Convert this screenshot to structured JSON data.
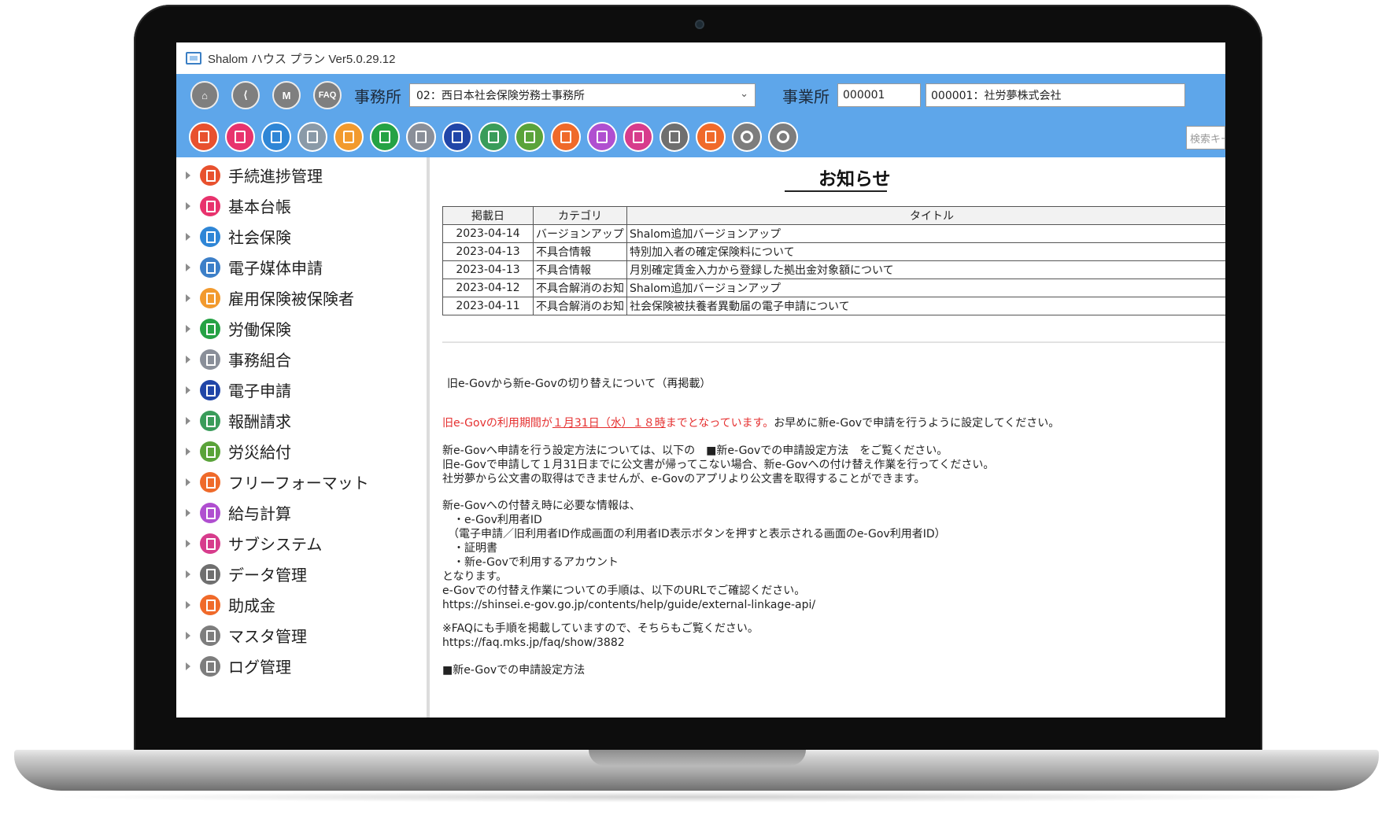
{
  "app": {
    "title": "Shalom ハウス プラン Ver5.0.29.12"
  },
  "toolbar": {
    "top_icons": [
      {
        "name": "home-icon",
        "glyph": "⌂"
      },
      {
        "name": "back-icon",
        "glyph": "⟨"
      },
      {
        "name": "manual-icon",
        "glyph": "M"
      },
      {
        "name": "faq-icon",
        "glyph": "FAQ"
      }
    ],
    "jimusho_label": "事務所",
    "jimusho_value": "02：西日本社会保険労務士事務所",
    "jigyosho_label": "事業所",
    "jigyosho_code": "000001",
    "jigyosho_name": "000001：社労夢株式会社",
    "search_placeholder": "検索キーワード",
    "function_icons": [
      {
        "name": "progress-icon",
        "color": "#e8512e"
      },
      {
        "name": "ledger-icon",
        "color": "#e8336d"
      },
      {
        "name": "social-insurance-icon",
        "color": "#2f86d6"
      },
      {
        "name": "media-icon",
        "color": "#8a9aa8"
      },
      {
        "name": "employment-insurance-icon",
        "color": "#f29a2e"
      },
      {
        "name": "labor-insurance-icon",
        "color": "#25a244"
      },
      {
        "name": "association-icon",
        "color": "#8a8f99"
      },
      {
        "name": "e-application-icon",
        "color": "#2146a8"
      },
      {
        "name": "fee-icon",
        "color": "#3a9c5a"
      },
      {
        "name": "accident-icon",
        "color": "#5aa33a"
      },
      {
        "name": "free-format-icon",
        "color": "#ef6a2a"
      },
      {
        "name": "payroll-icon",
        "color": "#b04fd0"
      },
      {
        "name": "subsystem-icon",
        "color": "#d73c8c"
      },
      {
        "name": "data-icon",
        "color": "#6f6f6f"
      },
      {
        "name": "subsidy-icon",
        "color": "#f06a2a"
      },
      {
        "name": "master-gear-icon",
        "color": "#7d7d7d"
      },
      {
        "name": "log-gear-icon",
        "color": "#7d7d7d"
      }
    ]
  },
  "sidebar": {
    "items": [
      {
        "label": "手続進捗管理",
        "color": "#e8512e",
        "icon": "progress-icon"
      },
      {
        "label": "基本台帳",
        "color": "#e8336d",
        "icon": "ledger-icon"
      },
      {
        "label": "社会保険",
        "color": "#2f86d6",
        "icon": "social-insurance-icon"
      },
      {
        "label": "電子媒体申請",
        "color": "#3c7fc8",
        "icon": "media-icon"
      },
      {
        "label": "雇用保険被保険者",
        "color": "#f29a2e",
        "icon": "employment-insurance-icon"
      },
      {
        "label": "労働保険",
        "color": "#25a244",
        "icon": "labor-insurance-icon"
      },
      {
        "label": "事務組合",
        "color": "#8a8f99",
        "icon": "association-icon"
      },
      {
        "label": "電子申請",
        "color": "#2146a8",
        "icon": "e-application-icon"
      },
      {
        "label": "報酬請求",
        "color": "#3a9c5a",
        "icon": "fee-icon"
      },
      {
        "label": "労災給付",
        "color": "#5aa33a",
        "icon": "accident-icon"
      },
      {
        "label": "フリーフォーマット",
        "color": "#ef6a2a",
        "icon": "free-format-icon"
      },
      {
        "label": "給与計算",
        "color": "#b04fd0",
        "icon": "payroll-icon"
      },
      {
        "label": "サブシステム",
        "color": "#d73c8c",
        "icon": "subsystem-icon"
      },
      {
        "label": "データ管理",
        "color": "#6f6f6f",
        "icon": "data-icon"
      },
      {
        "label": "助成金",
        "color": "#f06a2a",
        "icon": "subsidy-icon"
      },
      {
        "label": "マスタ管理",
        "color": "#7d7d7d",
        "icon": "gear-icon"
      },
      {
        "label": "ログ管理",
        "color": "#7d7d7d",
        "icon": "gear-icon"
      }
    ]
  },
  "notice": {
    "heading": "お知らせ",
    "columns": [
      "掲載日",
      "カテゴリ",
      "タイトル"
    ],
    "rows": [
      {
        "date": "2023-04-14",
        "category": "バージョンアップ",
        "title": "Shalom追加バージョンアップ"
      },
      {
        "date": "2023-04-13",
        "category": "不具合情報",
        "title": "特別加入者の確定保険料について"
      },
      {
        "date": "2023-04-13",
        "category": "不具合情報",
        "title": "月別確定賃金入力から登録した拠出金対象額について"
      },
      {
        "date": "2023-04-12",
        "category": "不具合解消のお知",
        "title": "Shalom追加バージョンアップ"
      },
      {
        "date": "2023-04-11",
        "category": "不具合解消のお知",
        "title": "社会保険被扶養者異動届の電子申請について"
      }
    ],
    "article_title": "旧e-Govから新e-Govの切り替えについて（再掲載）",
    "red_text": "旧e-Govの利用期間が",
    "red_underline": "１月31日（水）１８時",
    "red_text2": "までとなっています。",
    "red_after": "お早めに新e-Govで申請を行うように設定してください。",
    "para1": "新e-Govへ申請を行う設定方法については、以下の　■新e-Govでの申請設定方法　をご覧ください。\n旧e-Govで申請して１月31日までに公文書が帰ってこない場合、新e-Govへの付け替え作業を行ってください。\n社労夢から公文書の取得はできませんが、e-Govのアプリより公文書を取得することができます。",
    "para2": "新e-Govへの付替え時に必要な情報は、\n　・e-Gov利用者ID\n　（電子申請／旧利用者ID作成画面の利用者ID表示ボタンを押すと表示される画面のe-Gov利用者ID）\n　・証明書\n　・新e-Govで利用するアカウント\nとなります。\ne-Govでの付替え作業についての手順は、以下のURLでご確認ください。\nhttps://shinsei.e-gov.go.jp/contents/help/guide/external-linkage-api/",
    "para3": "※FAQにも手順を掲載していますので、そちらもご覧ください。\nhttps://faq.mks.jp/faq/show/3882",
    "para4": "■新e-Govでの申請設定方法"
  }
}
